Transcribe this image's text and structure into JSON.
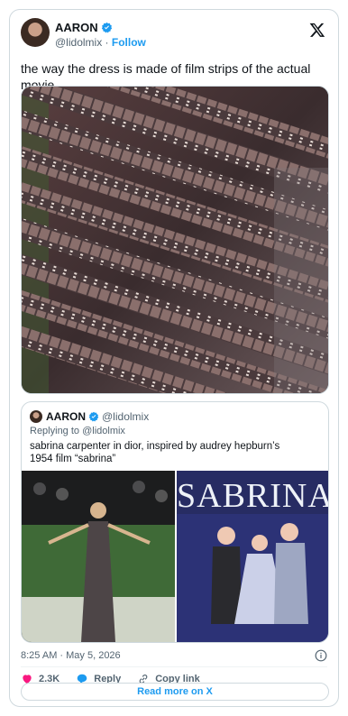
{
  "tweet": {
    "author_name": "AARON",
    "author_handle": "@lidolmix",
    "separator": "·",
    "follow_label": "Follow",
    "text": "the way the dress is made of film strips of the actual movie",
    "timestamp": "8:25 AM · May 5, 2026"
  },
  "quoted": {
    "author_name": "AARON",
    "author_handle": "@lidolmix",
    "replying_to": "Replying to @lidolmix",
    "text": "sabrina carpenter in dior, inspired by audrey hepburn’s 1954 film “sabrina”",
    "poster_title": "SABRINA"
  },
  "actions": {
    "likes_count": "2.3K",
    "reply_label": "Reply",
    "copy_link_label": "Copy link",
    "read_more_label": "Read more on X"
  },
  "colors": {
    "accent": "#1d9bf0",
    "like": "#f91880",
    "muted_text": "#536471",
    "border": "#cfd9de"
  },
  "icons": [
    "verified-badge-icon",
    "x-logo-icon",
    "info-icon",
    "heart-icon",
    "reply-bubble-icon",
    "link-icon"
  ]
}
